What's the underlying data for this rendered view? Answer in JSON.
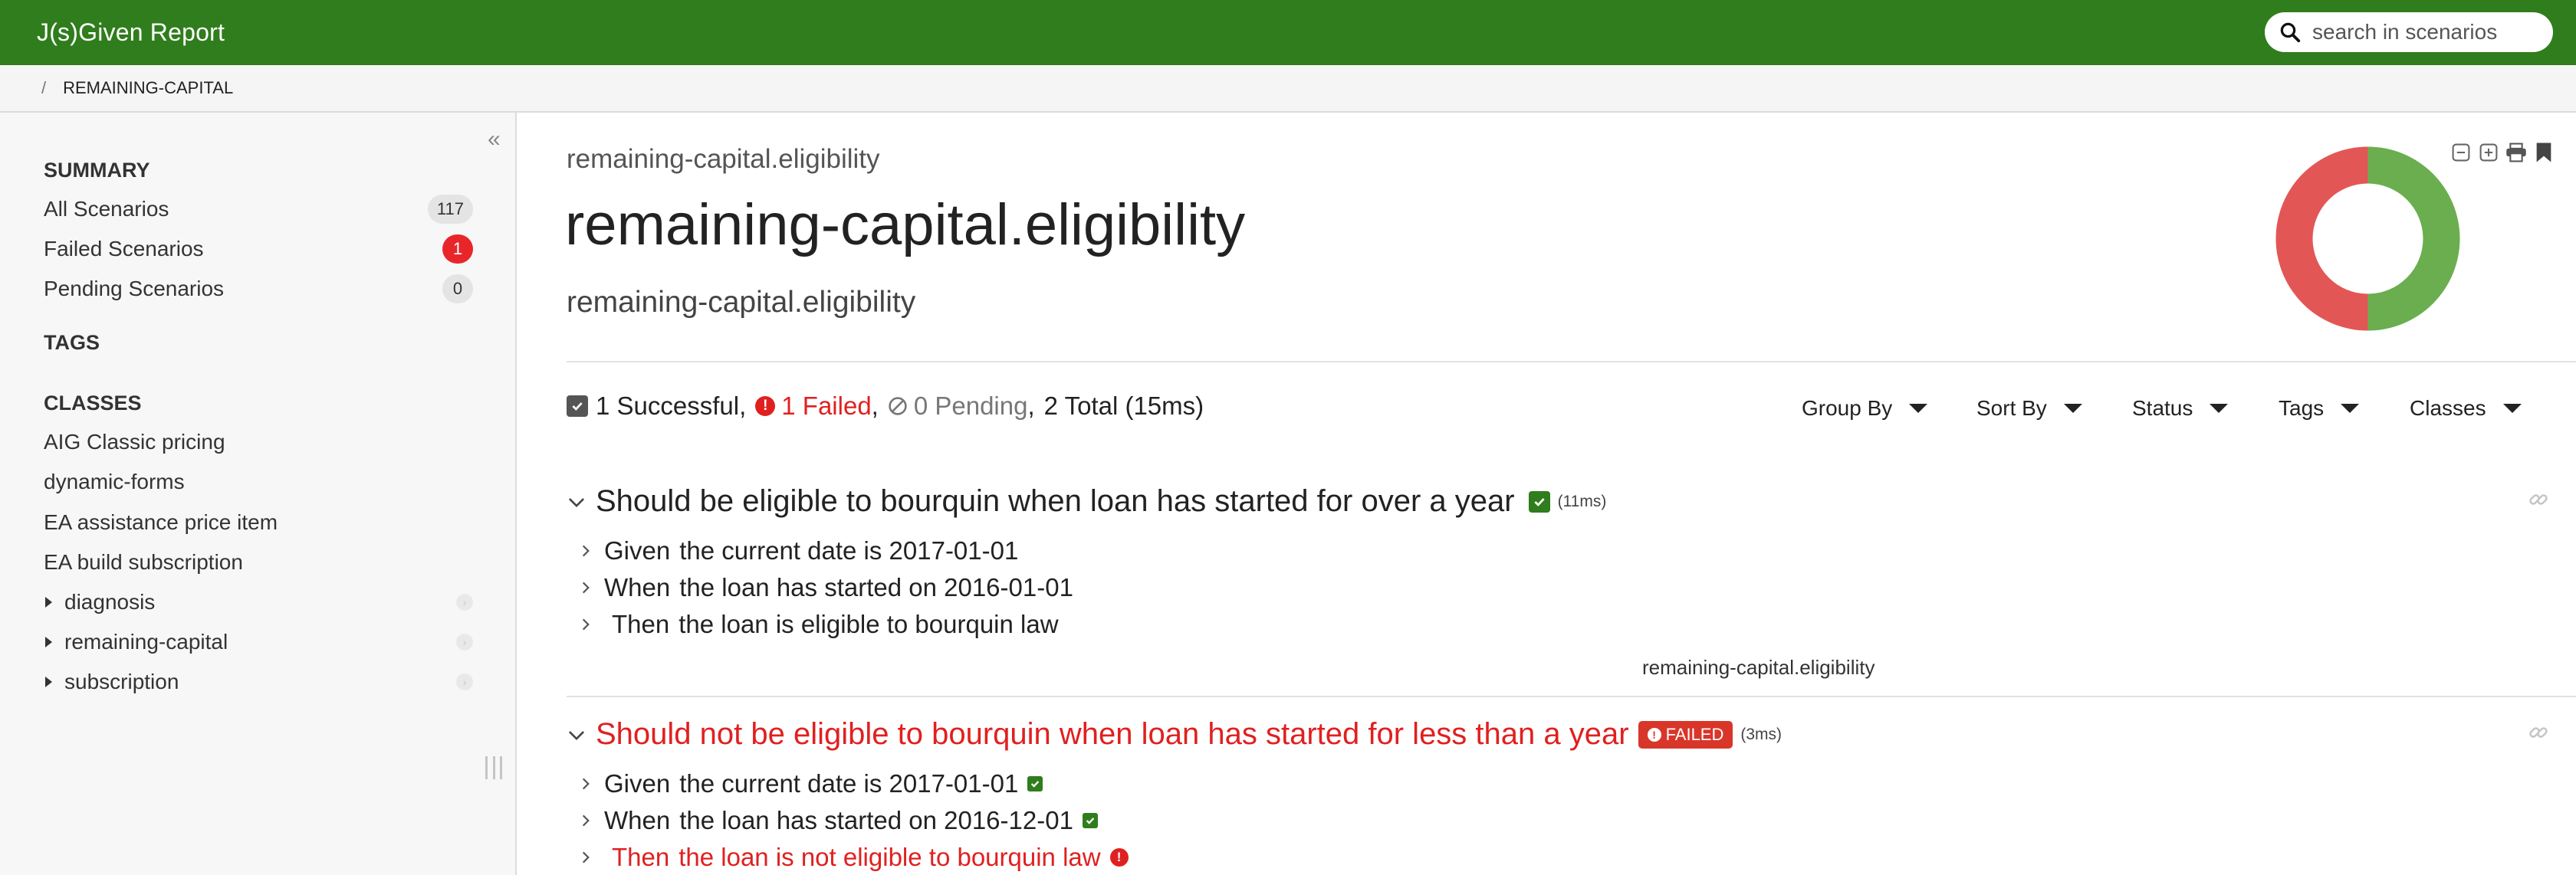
{
  "app": {
    "title": "J(s)Given Report"
  },
  "search": {
    "placeholder": "search in scenarios"
  },
  "breadcrumb": {
    "separator": "/",
    "current": "REMAINING-CAPITAL"
  },
  "sidebar": {
    "summary_heading": "SUMMARY",
    "summary_items": [
      {
        "label": "All Scenarios",
        "count": "117",
        "badge_color": "#e4e4e4"
      },
      {
        "label": "Failed Scenarios",
        "count": "1",
        "badge_color": "#e8262a"
      },
      {
        "label": "Pending Scenarios",
        "count": "0",
        "badge_color": "#e4e4e4"
      }
    ],
    "tags_heading": "TAGS",
    "classes_heading": "CLASSES",
    "classes": [
      "AIG Classic pricing",
      "dynamic-forms",
      "EA assistance price item",
      "EA build subscription"
    ],
    "tree": [
      "diagnosis",
      "remaining-capital",
      "subscription"
    ]
  },
  "header": {
    "pre_title": "remaining-capital.eligibility",
    "title": "remaining-capital.eligibility",
    "post_title": "remaining-capital.eligibility"
  },
  "stats": {
    "successful": "1 Successful",
    "failed": "1 Failed",
    "pending": "0 Pending",
    "total": "2 Total (15ms)",
    "comma": ","
  },
  "filters": [
    "Group By",
    "Sort By",
    "Status",
    "Tags",
    "Classes"
  ],
  "colors": {
    "accent_green": "#2f7d1c",
    "success": "#6aae4f",
    "failure": "#e35656",
    "error_red": "#e0201f"
  },
  "chart_data": {
    "type": "pie",
    "categories": [
      "Successful",
      "Failed"
    ],
    "values": [
      1,
      1
    ],
    "colors": [
      "#6aae4f",
      "#e35656"
    ]
  },
  "scenarios": [
    {
      "title": "Should be eligible to bourquin when loan has started for over a year",
      "status": "success",
      "duration": "(11ms)",
      "steps": [
        {
          "keyword": "Given",
          "text": "the current date is 2017-01-01"
        },
        {
          "keyword": "When",
          "text": "the loan has started on 2016-01-01"
        },
        {
          "keyword": "Then",
          "text": "the loan is eligible to bourquin law"
        }
      ],
      "tag": "remaining-capital.eligibility"
    },
    {
      "title": "Should not be eligible to bourquin when loan has started for less than a year",
      "status": "failed",
      "badge": "FAILED",
      "duration": "(3ms)",
      "steps": [
        {
          "keyword": "Given",
          "text": "the current date is 2017-01-01"
        },
        {
          "keyword": "When",
          "text": "the loan has started on 2016-12-01"
        },
        {
          "keyword": "Then",
          "text": "the loan is not eligible to bourquin law"
        }
      ]
    }
  ]
}
